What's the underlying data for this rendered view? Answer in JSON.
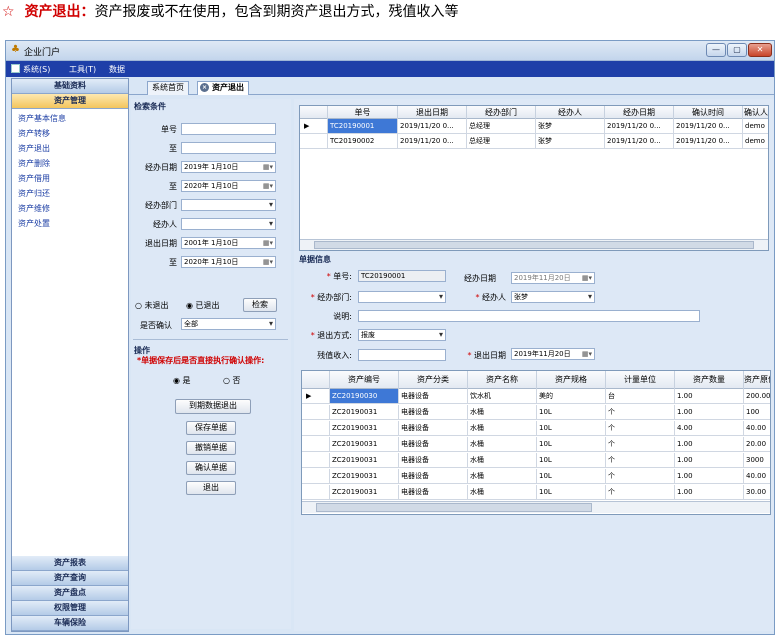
{
  "caption": {
    "star": "☆",
    "lead": "资产退出：",
    "desc": "资产报废或不在使用，包含到期资产退出方式，残值收入等"
  },
  "window": {
    "title": "企业门户",
    "min": "—",
    "max": "▢",
    "close": "✕"
  },
  "menubar": {
    "items": [
      "系统(S)",
      "工具(T)",
      "数据"
    ]
  },
  "sidebar": {
    "top_sections": [
      "基础资料",
      "资产管理"
    ],
    "items": [
      "资产基本信息",
      "资产转移",
      "资产退出",
      "资产删除",
      "资产借用",
      "资产归还",
      "资产维修",
      "资产处置"
    ],
    "bottom_sections": [
      "资产报表",
      "资产查询",
      "资产盘点",
      "权限管理",
      "车辆保险"
    ]
  },
  "tabs": [
    "系统首页",
    "资产退出"
  ],
  "search": {
    "title": "检索条件",
    "doc_no_label": "单号",
    "to_label": "至",
    "handle_date_label": "经办日期",
    "handle_date_from": "2019年 1月10日",
    "handle_date_to": "2020年 1月10日",
    "dept_label": "经办部门",
    "person_label": "经办人",
    "exit_date_label": "退出日期",
    "exit_date_from": "2001年 1月10日",
    "exit_date_to": "2020年 1月10日",
    "radio_not_exit": "未退出",
    "radio_exited": "已退出",
    "search_button": "检索",
    "confirm_label": "是否确认",
    "confirm_value": "全部"
  },
  "ops": {
    "title": "操作",
    "warning": "*单据保存后是否直接执行确认操作:",
    "yes": "是",
    "no": "否",
    "expire_exit": "到期数据退出",
    "save": "保存单据",
    "cancel": "撤销单据",
    "confirm": "确认单据",
    "exit": "退出"
  },
  "top_grid": {
    "columns": [
      "单号",
      "退出日期",
      "经办部门",
      "经办人",
      "经办日期",
      "确认时间",
      "确认人"
    ],
    "rows": [
      [
        "TC20190001",
        "2019/11/20 0...",
        "总经理",
        "张梦",
        "2019/11/20 0...",
        "2019/11/20 0...",
        "demo"
      ],
      [
        "TC20190002",
        "2019/11/20 0...",
        "总经理",
        "张梦",
        "2019/11/20 0...",
        "2019/11/20 0...",
        "demo"
      ]
    ],
    "row_marker": "▶"
  },
  "detail": {
    "title": "单据信息",
    "doc_no_label": "单号:",
    "doc_no": "TC20190001",
    "handle_date_label": "经办日期",
    "handle_date": "2019年11月20日",
    "dept_label": "经办部门:",
    "person_label": "经办人",
    "person": "张梦",
    "note_label": "说明:",
    "method_label": "退出方式:",
    "method": "报废",
    "residual_label": "残值收入:",
    "exit_date_label": "退出日期",
    "exit_date": "2019年11月20日"
  },
  "bottom_grid": {
    "columns": [
      "资产编号",
      "资产分类",
      "资产名称",
      "资产规格",
      "计量单位",
      "资产数量",
      "资产原值"
    ],
    "rows": [
      [
        "ZC20190030",
        "电器设备",
        "饮水机",
        "美的",
        "台",
        "1.00",
        "200.00"
      ],
      [
        "ZC20190031",
        "电器设备",
        "水桶",
        "10L",
        "个",
        "1.00",
        "100"
      ],
      [
        "ZC20190031",
        "电器设备",
        "水桶",
        "10L",
        "个",
        "4.00",
        "40.00"
      ],
      [
        "ZC20190031",
        "电器设备",
        "水桶",
        "10L",
        "个",
        "1.00",
        "20.00"
      ],
      [
        "ZC20190031",
        "电器设备",
        "水桶",
        "10L",
        "个",
        "1.00",
        "3000"
      ],
      [
        "ZC20190031",
        "电器设备",
        "水桶",
        "10L",
        "个",
        "1.00",
        "40.00"
      ],
      [
        "ZC20190031",
        "电器设备",
        "水桶",
        "10L",
        "个",
        "1.00",
        "30.00"
      ]
    ],
    "row_marker": "▶"
  },
  "colors": {
    "menubar": "#1e3fa8",
    "selection": "#3e78d6",
    "required": "#d00000"
  }
}
